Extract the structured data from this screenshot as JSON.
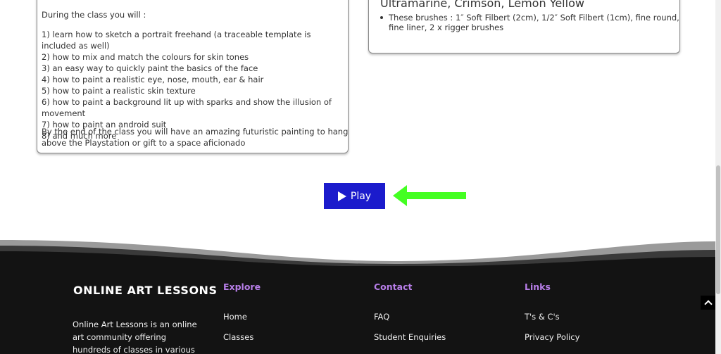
{
  "card_left": {
    "intro": "During the class you will :",
    "points": [
      "1) learn how to sketch a portrait freehand (a traceable template is included as well)",
      "2) how to mix and match the colours for skin tones",
      "3) an easy way to quickly paint the basics of the face",
      "4) how to paint a realistic eye, nose, mouth, ear & hair",
      "5) how to paint a realistic skin texture",
      "6) how to paint a background lit up with sparks and show the illusion of movement",
      "7) how to paint an android suit",
      "8) and much more"
    ],
    "closing": "By the end of the class you will have an amazing futuristic painting to hang above the Playstation or gift to a space aficionado"
  },
  "card_right": {
    "prev_item": "Ultramarine, Crimson, Lemon Yellow",
    "brushes": "These brushes : 1″ Soft Filbert (2cm), 1/2″ Soft Filbert (1cm), fine round, fine liner, 2 x rigger brushes"
  },
  "play": {
    "label": "Play",
    "icon": "play-icon",
    "color": "#1b1bcc"
  },
  "annotation": {
    "icon": "arrow-left-icon",
    "color": "#44ff22"
  },
  "footer": {
    "brand": "ONLINE ART LESSONS",
    "about": "Online Art Lessons is an online art community offering hundreds of classes in various art forms",
    "columns": [
      {
        "heading": "Explore",
        "links": [
          "Home",
          "Classes"
        ]
      },
      {
        "heading": "Contact",
        "links": [
          "FAQ",
          "Student Enquiries"
        ]
      },
      {
        "heading": "Links",
        "links": [
          "T's & C's",
          "Privacy Policy"
        ]
      }
    ],
    "heading_color": "#b77ee8",
    "background": "#131313"
  }
}
